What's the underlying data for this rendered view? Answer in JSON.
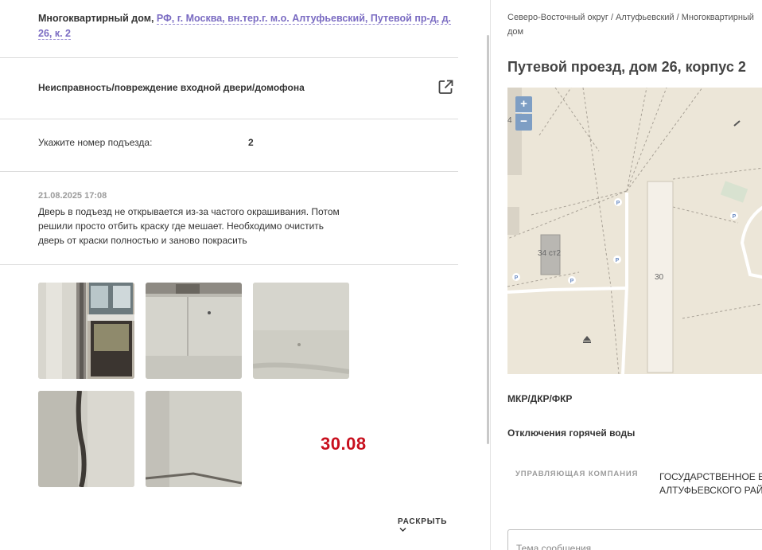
{
  "address": {
    "prefix": "Многоквартирный дом,",
    "link": "РФ, г. Москва, вн.тер.г. м.о. Алтуфьевский, Путевой пр-д, д. 26, к. 2"
  },
  "issue": {
    "title": "Неисправность/повреждение входной двери/домофона"
  },
  "entrance": {
    "label": "Укажите номер подъезда:",
    "value": "2"
  },
  "comment": {
    "date": "21.08.2025 17:08",
    "text": "Дверь в подъезд не открывается из-за частого окрашивания. Потом решили просто отбить краску где мешает. Необходимо очистить дверь от краски полностью и заново покрасить"
  },
  "photos_stamp": "30.08",
  "expand_label": "РАСКРЫТЬ",
  "right": {
    "breadcrumbs": "Северо-Восточный округ / Алтуфьевский / Многоквартирный дом",
    "building_title": "Путевой проезд, дом 26, корпус 2",
    "map": {
      "zoom_in": "+",
      "zoom_out": "−",
      "labels": {
        "bldg_34": "34 ст2",
        "bldg_30": "30",
        "edge": "4"
      }
    },
    "program": "МКР/ДКР/ФКР",
    "hot_water": "Отключения горячей воды",
    "management_label": "УПРАВЛЯЮЩАЯ КОМПАНИЯ",
    "management_value_line1": "ГОСУДАРСТВЕННОЕ Б",
    "management_value_line2": "АЛТУФЬЕВСКОГО РАЙ",
    "subject_placeholder": "Тема сообщения"
  },
  "colors": {
    "link": "#7a6bc2",
    "stamp": "#c8101e",
    "map_bg": "#ece6d8",
    "zoom": "#7e9ec4"
  }
}
